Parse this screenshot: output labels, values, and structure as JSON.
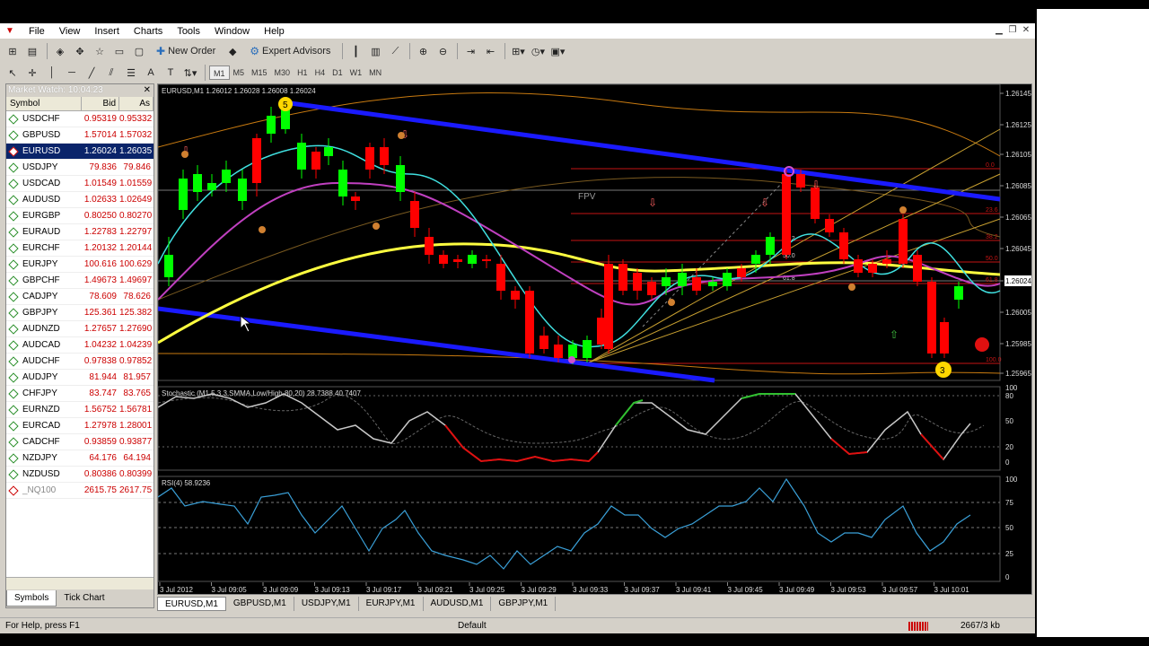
{
  "menu": {
    "items": [
      "File",
      "View",
      "Insert",
      "Charts",
      "Tools",
      "Window",
      "Help"
    ]
  },
  "toolbar": {
    "new_order": "New Order",
    "expert_advisors": "Expert Advisors"
  },
  "timeframes": [
    "M1",
    "M5",
    "M15",
    "M30",
    "H1",
    "H4",
    "D1",
    "W1",
    "MN"
  ],
  "market_watch": {
    "title": "Market Watch: 10:04:23",
    "headers": {
      "symbol": "Symbol",
      "bid": "Bid",
      "ask": "As"
    },
    "rows": [
      {
        "symbol": "USDCHF",
        "bid": "0.95319",
        "ask": "0.95332"
      },
      {
        "symbol": "GBPUSD",
        "bid": "1.57014",
        "ask": "1.57032"
      },
      {
        "symbol": "EURUSD",
        "bid": "1.26024",
        "ask": "1.26035"
      },
      {
        "symbol": "USDJPY",
        "bid": "79.836",
        "ask": "79.846"
      },
      {
        "symbol": "USDCAD",
        "bid": "1.01549",
        "ask": "1.01559"
      },
      {
        "symbol": "AUDUSD",
        "bid": "1.02633",
        "ask": "1.02649"
      },
      {
        "symbol": "EURGBP",
        "bid": "0.80250",
        "ask": "0.80270"
      },
      {
        "symbol": "EURAUD",
        "bid": "1.22783",
        "ask": "1.22797"
      },
      {
        "symbol": "EURCHF",
        "bid": "1.20132",
        "ask": "1.20144"
      },
      {
        "symbol": "EURJPY",
        "bid": "100.616",
        "ask": "100.629"
      },
      {
        "symbol": "GBPCHF",
        "bid": "1.49673",
        "ask": "1.49697"
      },
      {
        "symbol": "CADJPY",
        "bid": "78.609",
        "ask": "78.626"
      },
      {
        "symbol": "GBPJPY",
        "bid": "125.361",
        "ask": "125.382"
      },
      {
        "symbol": "AUDNZD",
        "bid": "1.27657",
        "ask": "1.27690"
      },
      {
        "symbol": "AUDCAD",
        "bid": "1.04232",
        "ask": "1.04239"
      },
      {
        "symbol": "AUDCHF",
        "bid": "0.97838",
        "ask": "0.97852"
      },
      {
        "symbol": "AUDJPY",
        "bid": "81.944",
        "ask": "81.957"
      },
      {
        "symbol": "CHFJPY",
        "bid": "83.747",
        "ask": "83.765"
      },
      {
        "symbol": "EURNZD",
        "bid": "1.56752",
        "ask": "1.56781"
      },
      {
        "symbol": "EURCAD",
        "bid": "1.27978",
        "ask": "1.28001"
      },
      {
        "symbol": "CADCHF",
        "bid": "0.93859",
        "ask": "0.93877"
      },
      {
        "symbol": "NZDJPY",
        "bid": "64.176",
        "ask": "64.194"
      },
      {
        "symbol": "NZDUSD",
        "bid": "0.80386",
        "ask": "0.80399"
      },
      {
        "symbol": "_NQ100",
        "bid": "2615.75",
        "ask": "2617.75"
      }
    ],
    "tabs": [
      "Symbols",
      "Tick Chart"
    ]
  },
  "chart": {
    "header": "EURUSD,M1  1.26012 1.26028 1.26008 1.26024",
    "price_labels": [
      "1.26145",
      "1.26125",
      "1.26105",
      "1.26085",
      "1.26065",
      "1.26045",
      "1.26024",
      "1.26005",
      "1.25985",
      "1.25965"
    ],
    "fib_labels": [
      "0.0",
      "23.6",
      "38.2",
      "50.0",
      "61.8",
      "100.0"
    ],
    "fib_mid_labels": [
      "38.2",
      "50.0",
      "61.8"
    ],
    "fpv_label": "FPV",
    "wave_labels": [
      "5",
      "3"
    ],
    "stochastic_header": "Stochastic (M1,5,3,3,SMMA,Low/High,80,20) 28.7388 40.7407",
    "stoch_levels": [
      "100",
      "80",
      "50",
      "20",
      "0"
    ],
    "rsi_header": "RSI(4) 58.9236",
    "rsi_levels": [
      "100",
      "75",
      "50",
      "25",
      "0"
    ],
    "time_labels": [
      "3 Jul 2012",
      "3 Jul 09:05",
      "3 Jul 09:09",
      "3 Jul 09:13",
      "3 Jul 09:17",
      "3 Jul 09:21",
      "3 Jul 09:25",
      "3 Jul 09:29",
      "3 Jul 09:33",
      "3 Jul 09:37",
      "3 Jul 09:41",
      "3 Jul 09:45",
      "3 Jul 09:49",
      "3 Jul 09:53",
      "3 Jul 09:57",
      "3 Jul 10:01"
    ]
  },
  "chart_tabs": [
    "EURUSD,M1",
    "GBPUSD,M1",
    "USDJPY,M1",
    "EURJPY,M1",
    "AUDUSD,M1",
    "GBPJPY,M1"
  ],
  "status": {
    "help": "For Help, press F1",
    "profile": "Default",
    "size": "2667/3 kb"
  },
  "colors": {
    "bull": "#00ff00",
    "bear": "#ff0000",
    "channel": "#1a1aff",
    "stoch": "#c8c8c8",
    "rsi": "#3aa0d8"
  }
}
